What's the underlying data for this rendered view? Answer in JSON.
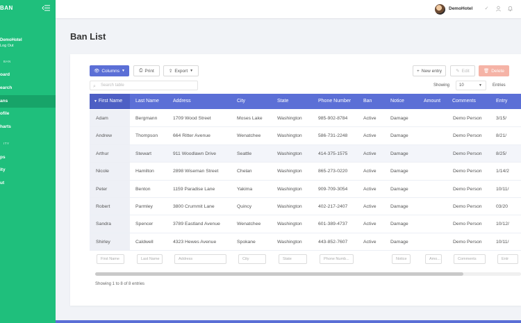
{
  "sidebar": {
    "brand": "BAN",
    "user_name": "DemoHotel",
    "user_sub": "Log Out",
    "section_ban": "BAN",
    "section_security": "ITY",
    "items": [
      {
        "label": "oard"
      },
      {
        "label": "earch"
      },
      {
        "label": "ans"
      },
      {
        "label": "ofile"
      },
      {
        "label": "harts"
      },
      {
        "label": "ps"
      },
      {
        "label": "ity"
      },
      {
        "label": "ut"
      }
    ]
  },
  "topbar": {
    "user_name": "DemoHotel"
  },
  "page": {
    "title": "Ban List"
  },
  "toolbar": {
    "columns": "Columns",
    "print": "Print",
    "export": "Export",
    "new_entry": "New entry",
    "edit": "Edit",
    "delete": "Delete"
  },
  "search": {
    "placeholder": "Search table"
  },
  "pager": {
    "showing_label": "Showing",
    "entries_value": "10",
    "entries_label": "Entries"
  },
  "table": {
    "headers": [
      "First Name",
      "Last Name",
      "Address",
      "City",
      "State",
      "Phone Number",
      "Ban",
      "Notice",
      "Amount",
      "Comments",
      "Entry"
    ],
    "rows": [
      [
        "Adam",
        "Bergmann",
        "1709 Wood Street",
        "Moses Lake",
        "Washington",
        "985-902-8784",
        "Active",
        "Damage",
        "",
        "Demo Person",
        "3/15/"
      ],
      [
        "Andrew",
        "Thompson",
        "664 Ritter Avenue",
        "Wenatchee",
        "Washington",
        "586-731-2248",
        "Active",
        "Damage",
        "",
        "Demo Person",
        "8/21/"
      ],
      [
        "Arthur",
        "Stewart",
        "911 Woodlawn Drive",
        "Seattle",
        "Washington",
        "414-375-1575",
        "Active",
        "Damage",
        "",
        "Demo Person",
        "8/25/"
      ],
      [
        "Nicole",
        "Hamilton",
        "2898 Wiseman Street",
        "Chelan",
        "Washington",
        "865-273-0220",
        "Active",
        "Damage",
        "",
        "Demo Person",
        "1/14/2"
      ],
      [
        "Peter",
        "Benton",
        "1159 Paradise Lane",
        "Yakima",
        "Washington",
        "909-709-3054",
        "Active",
        "Damage",
        "",
        "Demo Person",
        "10/11/"
      ],
      [
        "Robert",
        "Parmley",
        "3800 Crummit Lane",
        "Quincy",
        "Washington",
        "402-217-2407",
        "Active",
        "Damage",
        "",
        "Demo Person",
        "03/20"
      ],
      [
        "Sandra",
        "Spencer",
        "3789 Eastland Avenue",
        "Wenatchee",
        "Washington",
        "601-389-4737",
        "Active",
        "Damage",
        "",
        "Demo Person",
        "10/12/"
      ],
      [
        "Shirley",
        "Caldwell",
        "4323 Hewes Avenue",
        "Spokane",
        "Washington",
        "443-852-7607",
        "Active",
        "Damage",
        "",
        "Demo Person",
        "10/11/"
      ]
    ],
    "filters": [
      "First Name",
      "Last Name",
      "Address",
      "City",
      "State",
      "Phone Numb...",
      "Notice",
      "Amo...",
      "Comments",
      "Entr"
    ]
  },
  "footer": {
    "summary": "Showing 1 to 8 of 8 entries"
  },
  "colors": {
    "sidebar": "#1fbf7c",
    "accent": "#5b6fd6",
    "danger": "#f5b3a6"
  }
}
